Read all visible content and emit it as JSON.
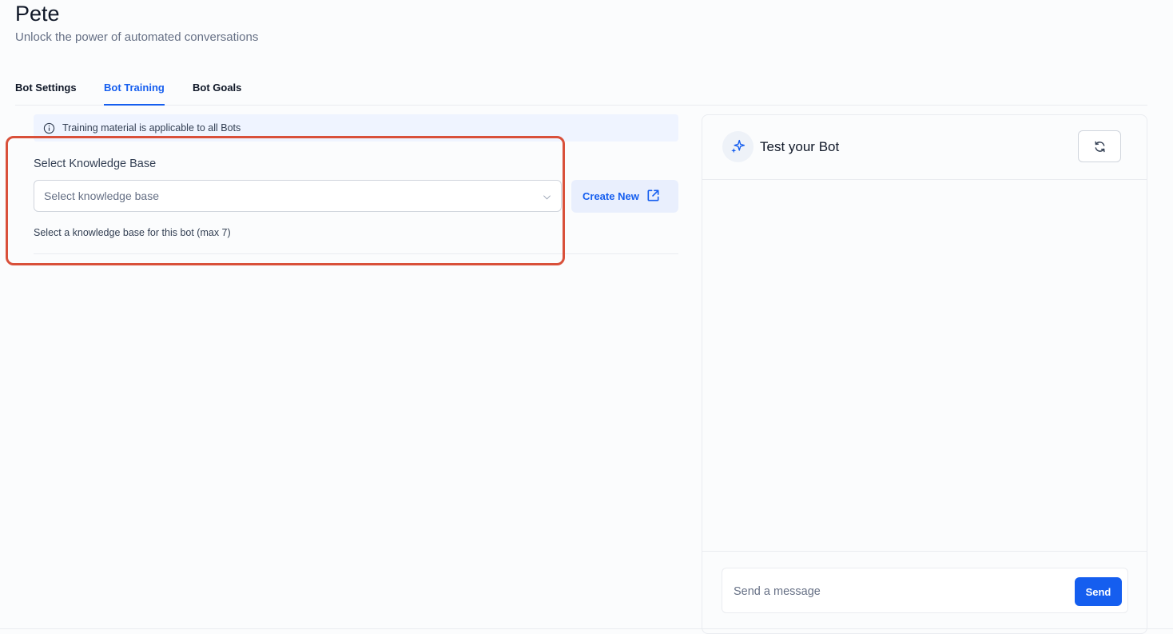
{
  "header": {
    "title": "Pete",
    "subtitle": "Unlock the power of automated conversations"
  },
  "tabs": [
    {
      "label": "Bot Settings",
      "active": false
    },
    {
      "label": "Bot Training",
      "active": true
    },
    {
      "label": "Bot Goals",
      "active": false
    }
  ],
  "notice": {
    "icon": "info-icon",
    "text": "Training material is applicable to all Bots"
  },
  "knowledge_base": {
    "label": "Select Knowledge Base",
    "placeholder": "Select knowledge base",
    "helper": "Select a knowledge base for this bot (max 7)",
    "create_label": "Create New",
    "create_icon": "external-link-icon",
    "highlight_color": "#d9503a"
  },
  "test_panel": {
    "title": "Test your Bot",
    "header_icon": "sparkle-icon",
    "refresh_icon": "refresh-icon",
    "input_placeholder": "Send a message",
    "send_label": "Send"
  },
  "colors": {
    "accent": "#155eef",
    "notice_bg": "#eff4ff",
    "create_bg": "#e9effd"
  }
}
